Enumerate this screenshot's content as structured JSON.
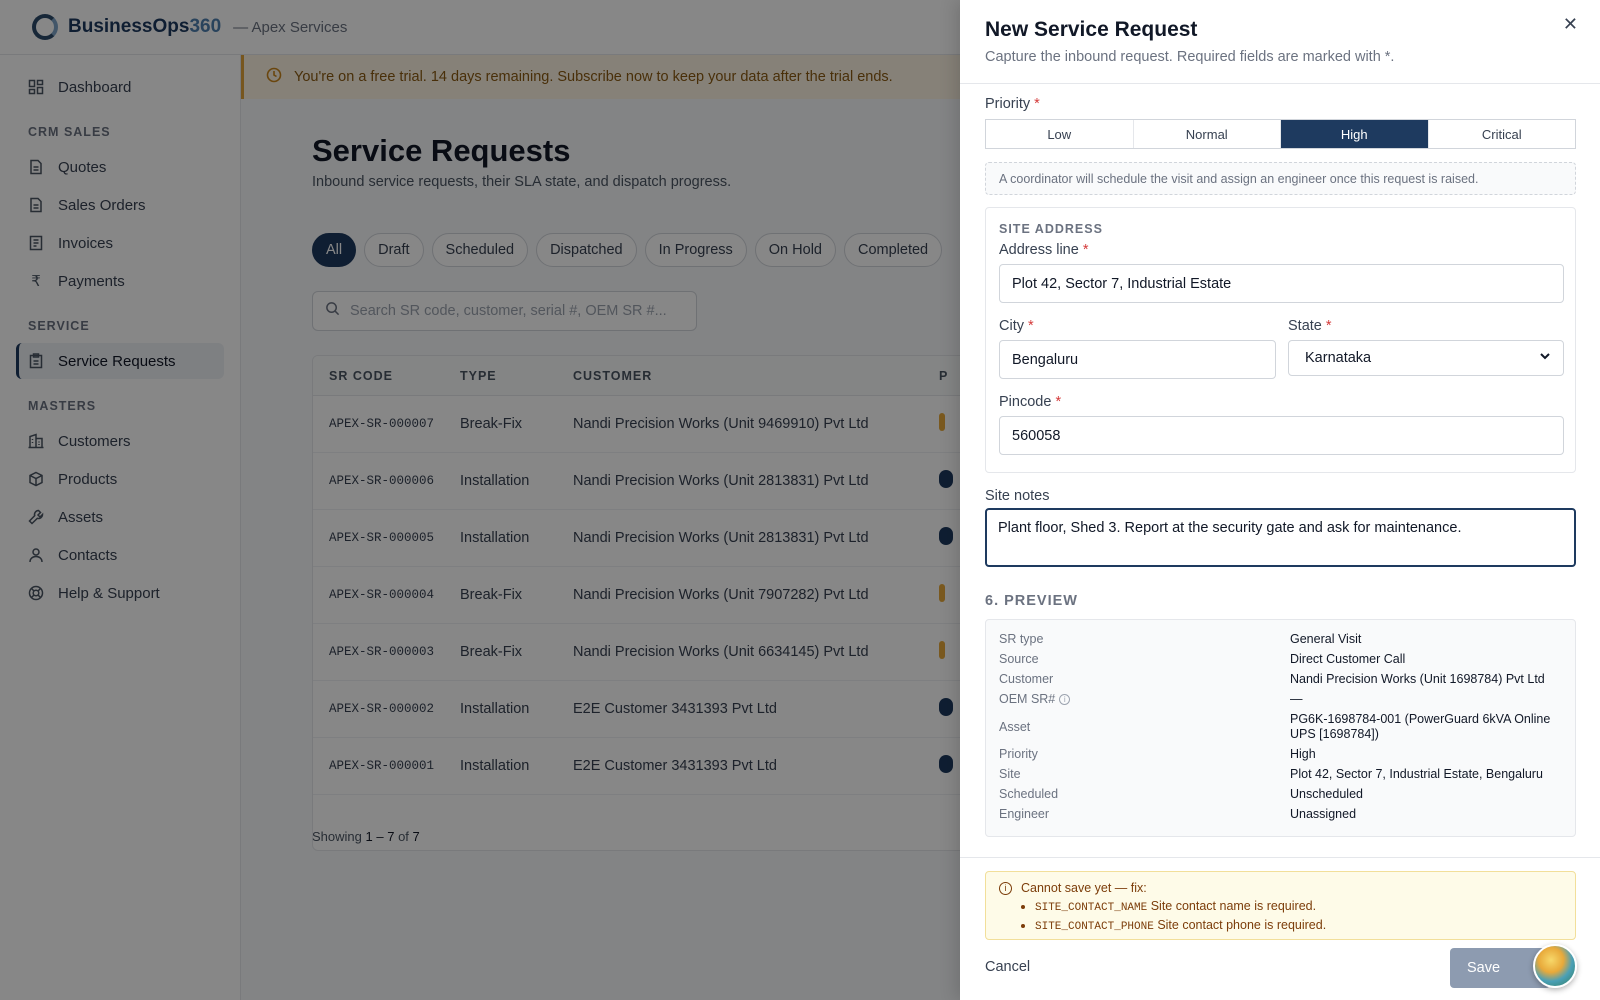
{
  "app": {
    "brand_main": "BusinessOps",
    "brand_num": "360",
    "tenant": "— Apex Services"
  },
  "sidebar": {
    "top": [
      {
        "label": "Dashboard",
        "icon": "dashboard-icon"
      }
    ],
    "sections": [
      {
        "title": "CRM SALES",
        "items": [
          {
            "label": "Quotes",
            "icon": "document-icon"
          },
          {
            "label": "Sales Orders",
            "icon": "document-icon"
          },
          {
            "label": "Invoices",
            "icon": "invoice-icon"
          },
          {
            "label": "Payments",
            "icon": "rupee-icon"
          }
        ]
      },
      {
        "title": "SERVICE",
        "items": [
          {
            "label": "Service Requests",
            "icon": "clipboard-icon",
            "active": true
          }
        ]
      },
      {
        "title": "MASTERS",
        "items": [
          {
            "label": "Customers",
            "icon": "building-icon"
          },
          {
            "label": "Products",
            "icon": "box-icon"
          },
          {
            "label": "Assets",
            "icon": "wrench-icon"
          },
          {
            "label": "Contacts",
            "icon": "person-icon"
          },
          {
            "label": "Help & Support",
            "icon": "lifebuoy-icon"
          }
        ]
      }
    ]
  },
  "trial_banner": "You're on a free trial. 14 days remaining. Subscribe now to keep your data after the trial ends.",
  "page": {
    "title": "Service Requests",
    "subtitle": "Inbound service requests, their SLA state, and dispatch progress.",
    "filters": [
      "All",
      "Draft",
      "Scheduled",
      "Dispatched",
      "In Progress",
      "On Hold",
      "Completed"
    ],
    "active_filter": "All",
    "search_placeholder": "Search SR code, customer, serial #, OEM SR #...",
    "columns": [
      "SR CODE",
      "TYPE",
      "CUSTOMER",
      "P"
    ],
    "rows": [
      {
        "code": "APEX-SR-000007",
        "type": "Break-Fix",
        "customer": "Nandi Precision Works (Unit 9469910) Pvt Ltd"
      },
      {
        "code": "APEX-SR-000006",
        "type": "Installation",
        "customer": "Nandi Precision Works (Unit 2813831) Pvt Ltd"
      },
      {
        "code": "APEX-SR-000005",
        "type": "Installation",
        "customer": "Nandi Precision Works (Unit 2813831) Pvt Ltd"
      },
      {
        "code": "APEX-SR-000004",
        "type": "Break-Fix",
        "customer": "Nandi Precision Works (Unit 7907282) Pvt Ltd"
      },
      {
        "code": "APEX-SR-000003",
        "type": "Break-Fix",
        "customer": "Nandi Precision Works (Unit 6634145) Pvt Ltd"
      },
      {
        "code": "APEX-SR-000002",
        "type": "Installation",
        "customer": "E2E Customer 3431393 Pvt Ltd"
      },
      {
        "code": "APEX-SR-000001",
        "type": "Installation",
        "customer": "E2E Customer 3431393 Pvt Ltd"
      }
    ],
    "showing_prefix": "Showing",
    "showing_from": "1",
    "showing_sep": "–",
    "showing_to": "7",
    "showing_of": "of",
    "showing_total": "7"
  },
  "drawer": {
    "title": "New Service Request",
    "subtitle": "Capture the inbound request. Required fields are marked with *.",
    "priority_label": "Priority",
    "priority_options": [
      "Low",
      "Normal",
      "High",
      "Critical"
    ],
    "priority_selected": "High",
    "note": "A coordinator will schedule the visit and assign an engineer once this request is raised.",
    "site_heading": "SITE ADDRESS",
    "address_label": "Address line",
    "address_value": "Plot 42, Sector 7, Industrial Estate",
    "city_label": "City",
    "city_value": "Bengaluru",
    "state_label": "State",
    "state_value": "Karnataka",
    "pincode_label": "Pincode",
    "pincode_value": "560058",
    "notes_label": "Site notes",
    "notes_value": "Plant floor, Shed 3. Report at the security gate and ask for maintenance.",
    "preview_heading": "6. PREVIEW",
    "preview": [
      {
        "k": "SR type",
        "v": "General Visit"
      },
      {
        "k": "Source",
        "v": "Direct Customer Call"
      },
      {
        "k": "Customer",
        "v": "Nandi Precision Works (Unit 1698784) Pvt Ltd"
      },
      {
        "k": "OEM SR#",
        "v": "—",
        "info": true
      },
      {
        "k": "Asset",
        "v": "PG6K-1698784-001 (PowerGuard 6kVA Online UPS [1698784])"
      },
      {
        "k": "Priority",
        "v": "High"
      },
      {
        "k": "Site",
        "v": "Plot 42, Sector 7, Industrial Estate, Bengaluru"
      },
      {
        "k": "Scheduled",
        "v": "Unscheduled"
      },
      {
        "k": "Engineer",
        "v": "Unassigned"
      }
    ],
    "error_title": "Cannot save yet — fix:",
    "errors": [
      {
        "code": "SITE_CONTACT_NAME",
        "msg": "Site contact name is required."
      },
      {
        "code": "SITE_CONTACT_PHONE",
        "msg": "Site contact phone is required."
      }
    ],
    "cancel_label": "Cancel",
    "save_label": "Save"
  },
  "colors": {
    "primary": "#1e3a5f",
    "required": "#d43a3a",
    "trial_bg": "#fdf4e3",
    "error_bg": "#fefbe8"
  }
}
